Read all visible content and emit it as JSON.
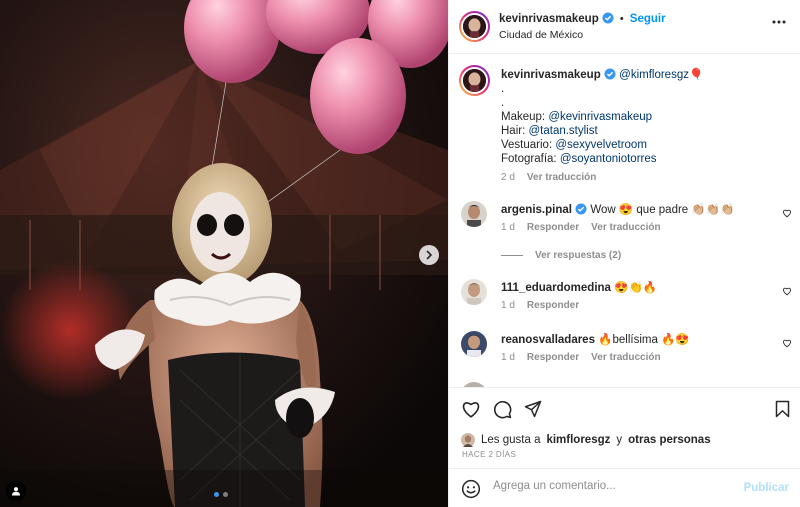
{
  "post": {
    "author": "kevinrivasmakeup",
    "follow_label": "Seguir",
    "location": "Ciudad de México",
    "carousel": {
      "current_slide": 1,
      "total_slides": 2
    }
  },
  "caption": {
    "author": "kevinrivasmakeup",
    "mention_primary": "@kimfloresgz",
    "emoji": "🎈",
    "lines": [
      ".",
      "."
    ],
    "credits": [
      {
        "label": "Makeup: ",
        "handle": "@kevinrivasmakeup"
      },
      {
        "label": "Hair: ",
        "handle": "@tatan.stylist"
      },
      {
        "label": "Vestuario: ",
        "handle": "@sexyvelvetroom"
      },
      {
        "label": "Fotografía: ",
        "handle": "@soyantoniotorres"
      }
    ],
    "time": "2 d",
    "translate": "Ver traducción"
  },
  "comments": [
    {
      "user": "argenis.pinal",
      "verified": true,
      "text": "Wow 😍 que padre 👏🏼👏🏼👏🏼",
      "time": "1 d",
      "reply": "Responder",
      "translate": "Ver traducción",
      "view_replies": "Ver respuestas (2)"
    },
    {
      "user": "111_eduardomedina",
      "verified": false,
      "text": "😍👏🔥",
      "time": "1 d",
      "reply": "Responder"
    },
    {
      "user": "reanosvalladares",
      "verified": false,
      "text": "🔥bellísima 🔥😍",
      "time": "1 d",
      "reply": "Responder",
      "translate": "Ver traducción"
    }
  ],
  "likes": {
    "prefix": "Les gusta a",
    "user": "kimfloresgz",
    "joiner": "y",
    "others": "otras personas"
  },
  "posted_ago": "HACE 2 DÍAS",
  "composer": {
    "emoji_icon": "smile-icon",
    "placeholder": "Agrega un comentario...",
    "publish": "Publicar"
  },
  "colors": {
    "link": "#00376b",
    "accent": "#0095f6",
    "publish_disabled": "#b2dffc",
    "muted": "#8e8e8e",
    "verified": "#3897f0"
  },
  "icons": [
    "more-icon",
    "verified-icon",
    "heart-icon",
    "comment-icon",
    "share-icon",
    "bookmark-icon",
    "chevron-right-icon",
    "user-tag-icon",
    "smile-icon"
  ]
}
